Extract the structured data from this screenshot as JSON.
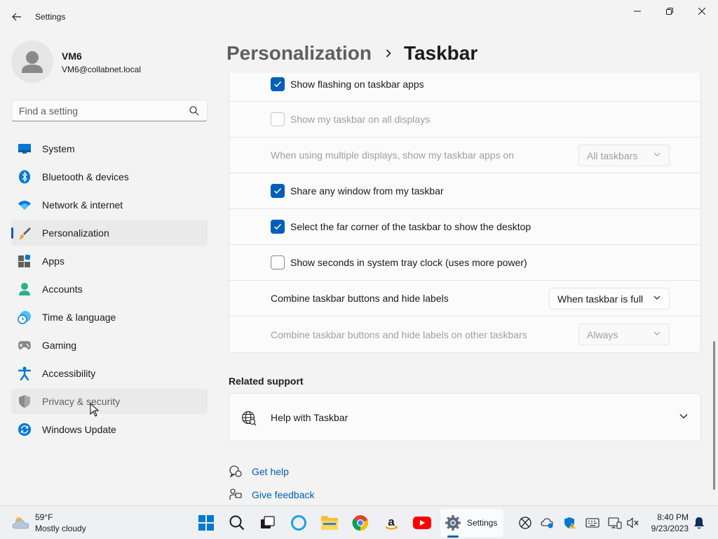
{
  "window": {
    "title": "Settings"
  },
  "profile": {
    "name": "VM6",
    "email": "VM6@collabnet.local"
  },
  "search": {
    "placeholder": "Find a setting"
  },
  "nav": {
    "items": [
      {
        "label": "System",
        "icon": "monitor-icon"
      },
      {
        "label": "Bluetooth & devices",
        "icon": "bluetooth-icon"
      },
      {
        "label": "Network & internet",
        "icon": "wifi-icon"
      },
      {
        "label": "Personalization",
        "icon": "brush-icon",
        "active": true
      },
      {
        "label": "Apps",
        "icon": "apps-icon"
      },
      {
        "label": "Accounts",
        "icon": "person-icon"
      },
      {
        "label": "Time & language",
        "icon": "globe-clock-icon"
      },
      {
        "label": "Gaming",
        "icon": "gamepad-icon"
      },
      {
        "label": "Accessibility",
        "icon": "accessibility-icon"
      },
      {
        "label": "Privacy & security",
        "icon": "shield-icon",
        "hover": true
      },
      {
        "label": "Windows Update",
        "icon": "update-icon"
      }
    ]
  },
  "header": {
    "parent": "Personalization",
    "current": "Taskbar"
  },
  "settings": {
    "rows": [
      {
        "label": "Show flashing on taskbar apps",
        "type": "checkbox",
        "checked": true,
        "disabled": false
      },
      {
        "label": "Show my taskbar on all displays",
        "type": "checkbox",
        "checked": false,
        "disabled": true
      },
      {
        "label": "When using multiple displays, show my taskbar apps on",
        "type": "dropdown",
        "value": "All taskbars",
        "disabled": true
      },
      {
        "label": "Share any window from my taskbar",
        "type": "checkbox",
        "checked": true,
        "disabled": false
      },
      {
        "label": "Select the far corner of the taskbar to show the desktop",
        "type": "checkbox",
        "checked": true,
        "disabled": false
      },
      {
        "label": "Show seconds in system tray clock (uses more power)",
        "type": "checkbox",
        "checked": false,
        "disabled": false
      },
      {
        "label": "Combine taskbar buttons and hide labels",
        "type": "dropdown",
        "value": "When taskbar is full",
        "disabled": false
      },
      {
        "label": "Combine taskbar buttons and hide labels on other taskbars",
        "type": "dropdown",
        "value": "Always",
        "disabled": true
      }
    ]
  },
  "related": {
    "title": "Related support",
    "help_item": "Help with Taskbar"
  },
  "links": {
    "get_help": "Get help",
    "give_feedback": "Give feedback"
  },
  "taskbar": {
    "weather_temp": "59°F",
    "weather_desc": "Mostly cloudy",
    "settings_label": "Settings",
    "time": "8:40 PM",
    "date": "9/23/2023"
  },
  "colors": {
    "accent": "#005fb8",
    "background": "#f3f3f3",
    "card": "#fbfbfb"
  }
}
